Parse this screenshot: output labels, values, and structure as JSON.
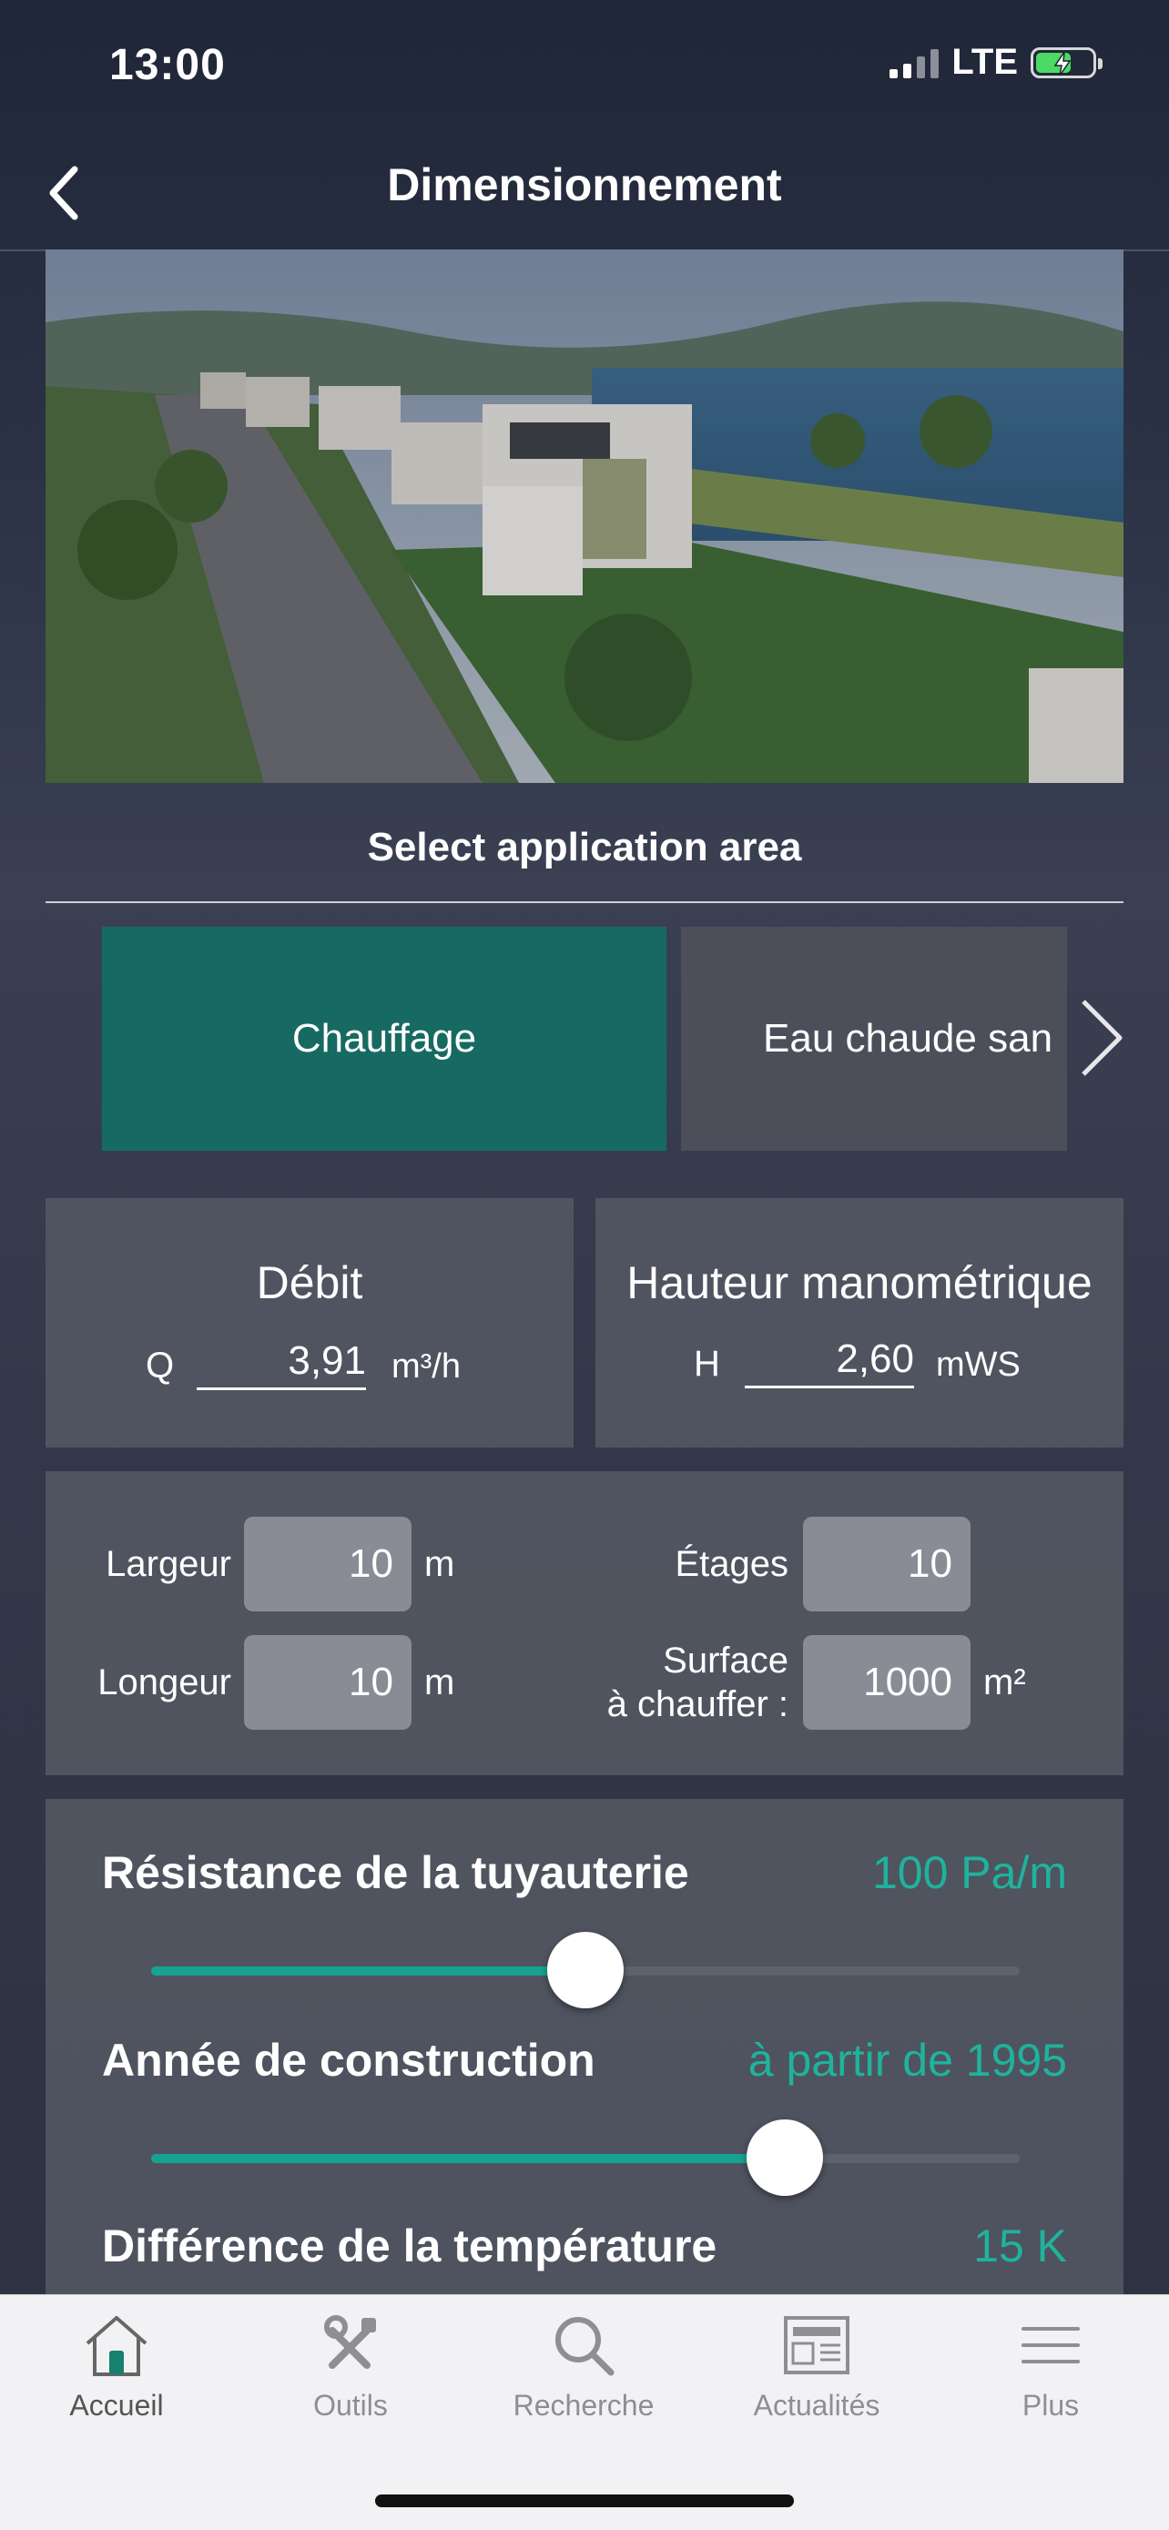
{
  "status_bar": {
    "time": "13:00",
    "network": "LTE"
  },
  "nav": {
    "title": "Dimensionnement"
  },
  "section": {
    "title": "Select application area"
  },
  "application_tabs": [
    {
      "label": "Chauffage",
      "active": true
    },
    {
      "label": "Eau chaude san",
      "active": false
    }
  ],
  "flow": {
    "label": "Débit",
    "prefix": "Q",
    "value": "3,91",
    "unit": "m³/h"
  },
  "head": {
    "label": "Hauteur manométrique",
    "prefix": "H",
    "value": "2,60",
    "unit": "mWS"
  },
  "dimensions": {
    "width": {
      "label": "Largeur",
      "value": "10",
      "unit": "m"
    },
    "length": {
      "label": "Longeur",
      "value": "10",
      "unit": "m"
    },
    "floors": {
      "label": "Étages",
      "value": "10"
    },
    "surface": {
      "label_line1": "Surface",
      "label_line2": "à chauffer :",
      "value": "1000",
      "unit": "m²"
    }
  },
  "sliders": [
    {
      "label": "Résistance de la tuyauterie",
      "value": "100 Pa/m",
      "fraction": 0.5
    },
    {
      "label": "Année de construction",
      "value": "à partir de 1995",
      "fraction": 0.73
    },
    {
      "label": "Différence de la température",
      "value": "15 K"
    }
  ],
  "tabbar": [
    {
      "label": "Accueil",
      "icon": "home-icon",
      "active": true
    },
    {
      "label": "Outils",
      "icon": "tools-icon",
      "active": false
    },
    {
      "label": "Recherche",
      "icon": "search-icon",
      "active": false
    },
    {
      "label": "Actualités",
      "icon": "news-icon",
      "active": false
    },
    {
      "label": "Plus",
      "icon": "menu-icon",
      "active": false
    }
  ],
  "colors": {
    "accent": "#17a38f",
    "active_tab": "#176a61"
  }
}
